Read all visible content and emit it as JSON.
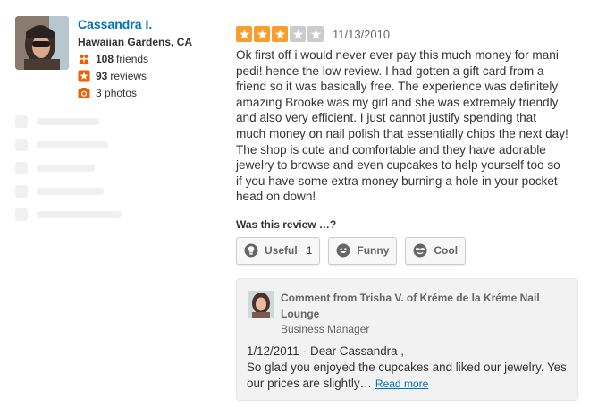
{
  "user": {
    "name": "Cassandra I.",
    "location": "Hawaiian Gardens, CA",
    "friends_count": "108",
    "friends_label": "friends",
    "reviews_count": "93",
    "reviews_label": "reviews",
    "photos_count": "3",
    "photos_label": "photos"
  },
  "review": {
    "rating": 3,
    "max_rating": 5,
    "date": "11/13/2010",
    "text": "Ok first off i would never ever pay this much money for mani pedi! hence the low review.  I had gotten a gift card from a friend so it was basically free.   The experience was definitely amazing Brooke was my girl and she was extremely friendly and also very efficient.  I just cannot justify spending that much money on nail polish that essentially chips the next day! The shop is cute and comfortable and they have adorable jewelry to browse and even cupcakes to help yourself too so if you have some extra money burning a hole in your pocket head on down!"
  },
  "votes": {
    "question": "Was this review …?",
    "useful_label": "Useful",
    "useful_count": "1",
    "funny_label": "Funny",
    "cool_label": "Cool"
  },
  "comment": {
    "heading": "Comment from Trisha V. of Kréme de la Kréme Nail Lounge",
    "role": "Business Manager",
    "date": "1/12/2011",
    "separator": "·",
    "text": "Dear Cassandra ,\nSo glad you enjoyed the cupcakes and liked our jewelry. Yes our prices are slightly…",
    "read_more": "Read more"
  },
  "colors": {
    "link": "#0073bb",
    "star_filled": "#f99e2c",
    "star_empty": "#cccccc",
    "friends_icon": "#f15c00",
    "reviews_icon": "#f15c00",
    "photos_icon": "#f15c00"
  },
  "icons": {
    "friends": "friends-icon",
    "reviews": "star-badge-icon",
    "photos": "camera-icon",
    "useful": "lightbulb-icon",
    "funny": "smiley-icon",
    "cool": "sunglasses-icon"
  }
}
